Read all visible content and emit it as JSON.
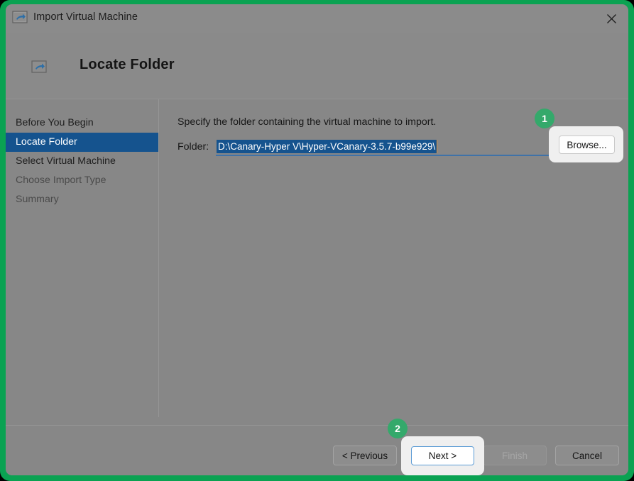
{
  "window": {
    "title": "Import Virtual Machine",
    "app_icon": "import-vm-icon",
    "close_icon": "close-icon"
  },
  "header": {
    "icon": "import-vm-icon",
    "title": "Locate Folder"
  },
  "sidebar": {
    "items": [
      {
        "label": "Before You Begin",
        "state": "normal"
      },
      {
        "label": "Locate Folder",
        "state": "selected"
      },
      {
        "label": "Select Virtual Machine",
        "state": "normal"
      },
      {
        "label": "Choose Import Type",
        "state": "dim"
      },
      {
        "label": "Summary",
        "state": "dim"
      }
    ]
  },
  "main": {
    "instruction": "Specify the folder containing the virtual machine to import.",
    "folder_label": "Folder:",
    "folder_value": "D:\\Canary-Hyper V\\Hyper-VCanary-3.5.7-b99e929\\",
    "folder_placeholder": "",
    "browse_label": "Browse..."
  },
  "footer": {
    "previous_label": "< Previous",
    "next_label": "Next >",
    "finish_label": "Finish",
    "cancel_label": "Cancel"
  },
  "badges": {
    "one": "1",
    "two": "2"
  },
  "colors": {
    "highlight_frame": "#0aa252",
    "badge_green": "#34a96b",
    "selection_blue": "#15538e",
    "focus_border": "#5b9bd5",
    "window_gray": "#878787"
  }
}
